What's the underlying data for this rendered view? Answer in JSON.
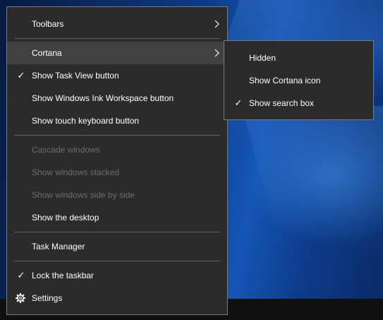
{
  "context_menu": {
    "items": [
      {
        "label": "Toolbars"
      },
      {
        "label": "Cortana"
      },
      {
        "label": "Show Task View button"
      },
      {
        "label": "Show Windows Ink Workspace button"
      },
      {
        "label": "Show touch keyboard button"
      },
      {
        "label": "Cascade windows"
      },
      {
        "label": "Show windows stacked"
      },
      {
        "label": "Show windows side by side"
      },
      {
        "label": "Show the desktop"
      },
      {
        "label": "Task Manager"
      },
      {
        "label": "Lock the taskbar"
      },
      {
        "label": "Settings"
      }
    ]
  },
  "cortana_submenu": {
    "items": [
      {
        "label": "Hidden"
      },
      {
        "label": "Show Cortana icon"
      },
      {
        "label": "Show search box"
      }
    ]
  },
  "icons": {
    "checkmark": "checkmark-icon",
    "chevron": "chevron-right-icon",
    "settings": "gear-icon"
  },
  "colors": {
    "menu_bg": "#2b2b2b",
    "menu_border": "#7a7a7a",
    "highlight": "#414141",
    "text": "#ffffff",
    "disabled_text": "#6d6d6d"
  }
}
